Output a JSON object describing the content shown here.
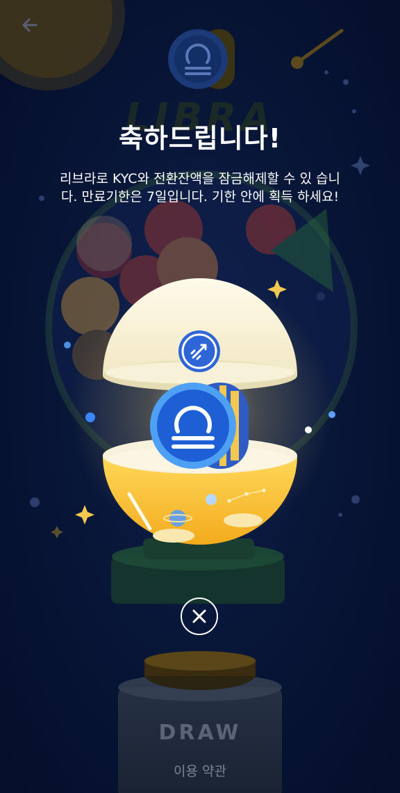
{
  "header": {
    "back_icon": "arrow-left-icon",
    "brand_word": "LIBRA"
  },
  "dialog": {
    "title": "축하드립니다!",
    "message": "리브라로 KYC와 전환잔액을 잠금해제할 수 있 습니다. 만료기한은 7일입니다. 기한 안에 획득 하세요!",
    "close_icon": "close-icon"
  },
  "reward": {
    "coin_icon": "libra-coin-icon",
    "badge_icon": "rocket-icon"
  },
  "machine": {
    "draw_label": "DRAW",
    "terms_label": "이용 약관"
  },
  "colors": {
    "background": "#061234",
    "coin_blue": "#1f5fd6",
    "capsule_yellow": "#f6c23a",
    "accent_gold": "#f3c851"
  }
}
